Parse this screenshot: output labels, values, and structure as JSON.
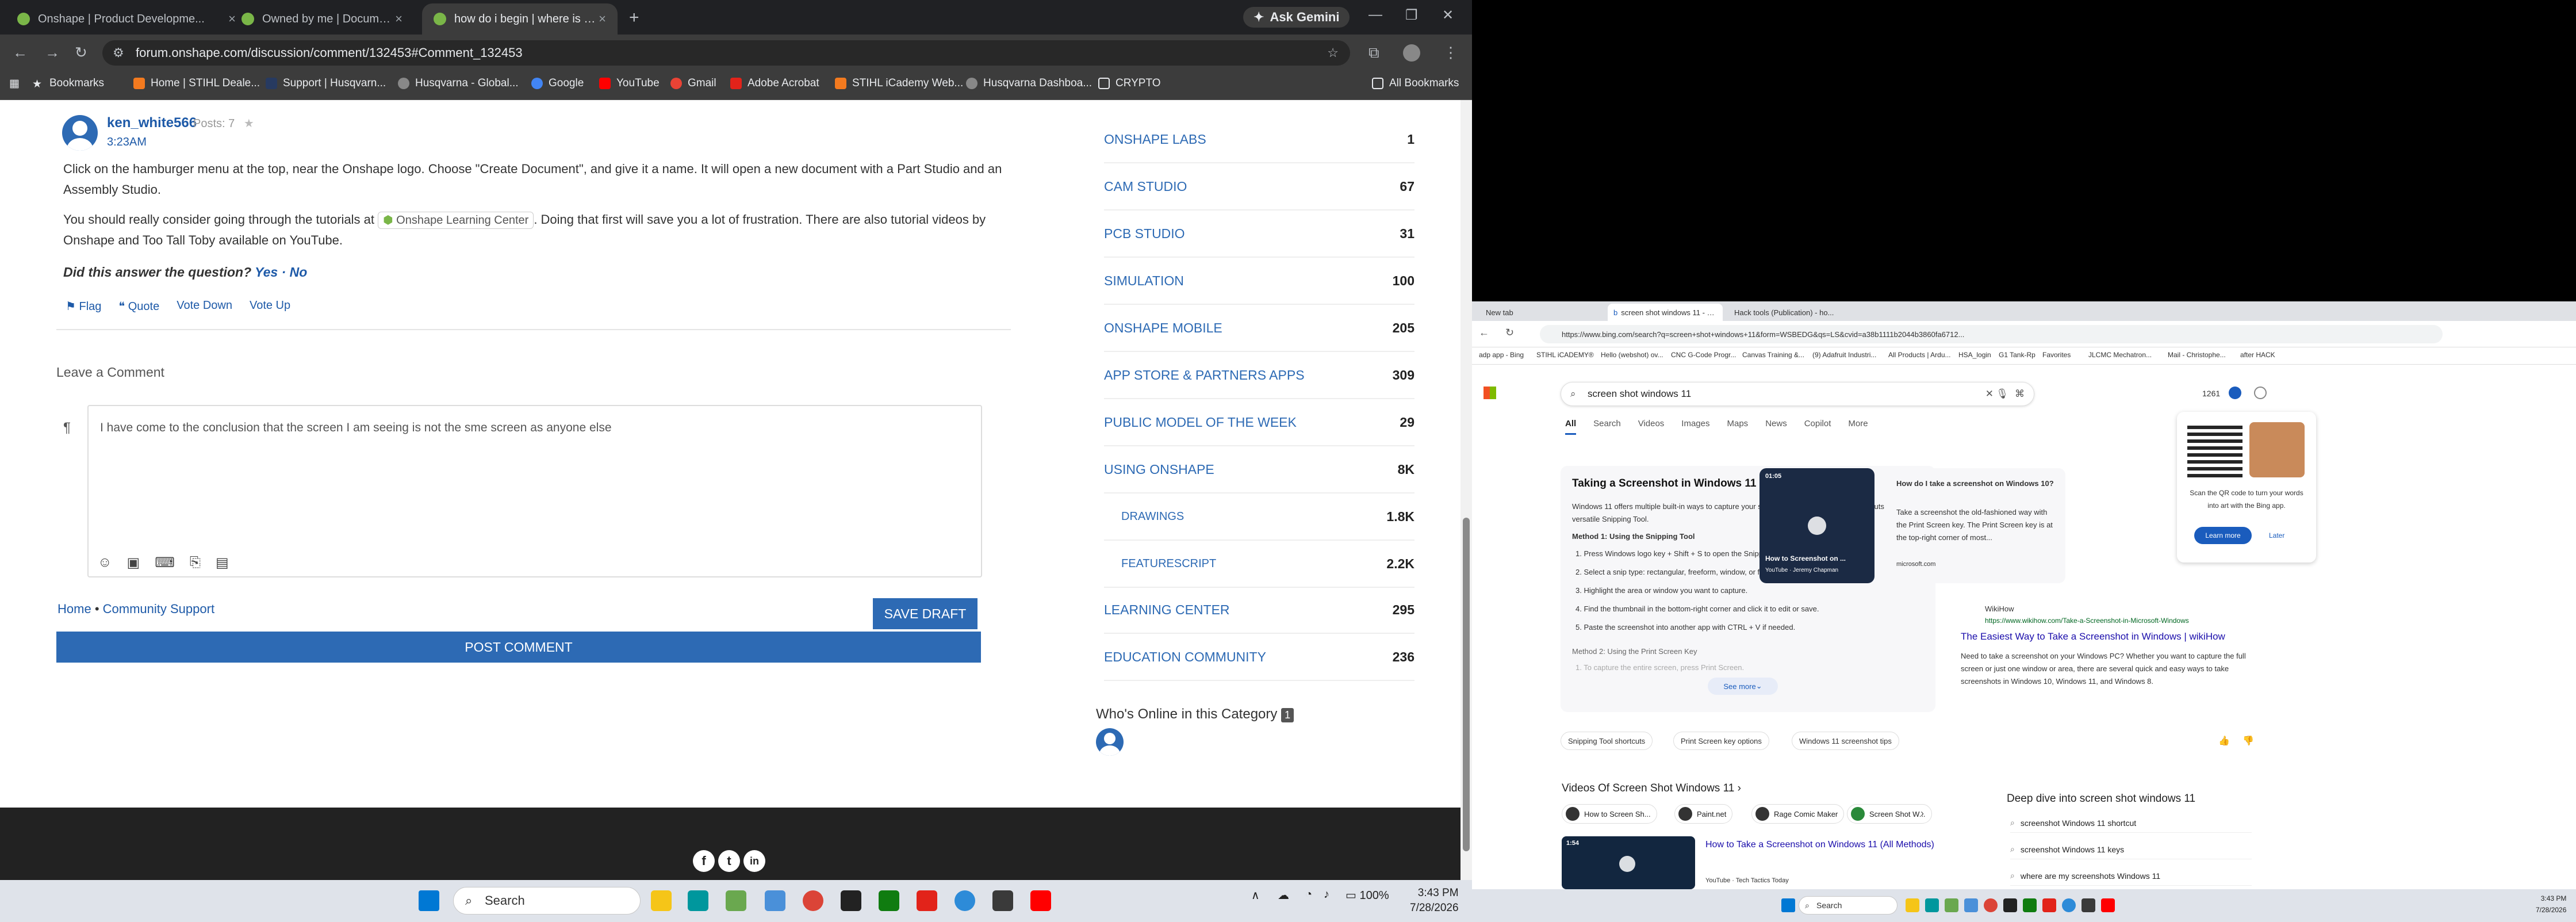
{
  "left_browser": {
    "tabs": [
      {
        "label": "Onshape | Product Developme..."
      },
      {
        "label": "Owned by me | Documents"
      },
      {
        "label": "how do i begin | where is the C..."
      }
    ],
    "ask_gemini": "Ask Gemini",
    "url": "forum.onshape.com/discussion/comment/132453#Comment_132453",
    "bookmarks": [
      "Bookmarks",
      "Home | STIHL Deale...",
      "Support | Husqvarn...",
      "Husqvarna - Global...",
      "Google",
      "YouTube",
      "Gmail",
      "Adobe Acrobat",
      "STIHL iCademy Web...",
      "Husqvarna Dashboa...",
      "CRYPTO"
    ],
    "all_bookmarks": "All Bookmarks"
  },
  "post": {
    "username": "ken_white566",
    "posts": "Posts: 7",
    "star": "★",
    "time": "3:23AM",
    "p1": "Click on the hamburger menu at the top, near the Onshape logo. Choose \"Create Document\", and give it a name. It will open a new document with a Part Studio and an Assembly Studio.",
    "p2_a": "You should really consider going through the tutorials at",
    "p2_link": "Onshape Learning Center",
    "p2_b": ". Doing that first will save you a lot of frustration. There are also tutorial videos by Onshape and Too Tall Toby available on YouTube.",
    "question": "Did this answer the question?",
    "yes": "Yes",
    "dot": "·",
    "no": "No",
    "actions": [
      "Flag",
      "Quote",
      "Vote Down",
      "Vote Up"
    ]
  },
  "comment": {
    "heading": "Leave a Comment",
    "pilcrow": "¶",
    "text": "I have come to the conclusion that the screen I am seeing is not the sme screen as anyone else",
    "breadcrumb_home": "Home",
    "breadcrumb_sep": "•",
    "breadcrumb_support": "Community Support",
    "save_draft": "SAVE DRAFT",
    "post_comment": "POST COMMENT"
  },
  "categories": [
    {
      "name": "ONSHAPE LABS",
      "count": "1"
    },
    {
      "name": "CAM STUDIO",
      "count": "67"
    },
    {
      "name": "PCB STUDIO",
      "count": "31"
    },
    {
      "name": "SIMULATION",
      "count": "100"
    },
    {
      "name": "ONSHAPE MOBILE",
      "count": "205"
    },
    {
      "name": "APP STORE & PARTNERS APPS",
      "count": "309"
    },
    {
      "name": "PUBLIC MODEL OF THE WEEK",
      "count": "29"
    },
    {
      "name": "USING ONSHAPE",
      "count": "8K"
    },
    {
      "name": "DRAWINGS",
      "count": "1.8K"
    },
    {
      "name": "FEATURESCRIPT",
      "count": "2.2K"
    },
    {
      "name": "LEARNING CENTER",
      "count": "295"
    },
    {
      "name": "EDUCATION COMMUNITY",
      "count": "236"
    }
  ],
  "who_online": "Who's Online in this Category",
  "who_online_count": "1",
  "footer_social": [
    "f",
    "t",
    "in"
  ],
  "taskbar": {
    "search": "Search",
    "time": "3:43 PM",
    "date": "7/28/2026",
    "battery": "100%"
  },
  "right_browser": {
    "tabs": [
      {
        "label": "New tab"
      },
      {
        "label": "screen shot windows 11 - Search"
      },
      {
        "label": "Hack tools (Publication) - ho..."
      }
    ],
    "url": "https://www.bing.com/search?q=screen+shot+windows+11&form=WSBEDG&qs=LS&cvid=a38b1111b2044b3860fa6712...",
    "bookmarks": [
      "adp app - Bing",
      "STIHL iCADEMY®",
      "Hello (webshot) ov...",
      "CNC G-Code Progr...",
      "Canvas Training &...",
      "(9) Adafruit Industri...",
      "All Products | Ardu...",
      "HSA_login",
      "G1 Tank-Rp",
      "Favorites",
      "JLCMC Mechatron...",
      "Mail - Christophe...",
      "after HACK"
    ],
    "search_query": "screen shot windows 11",
    "rewards": "1261",
    "nav": [
      "All",
      "Search",
      "Videos",
      "Images",
      "Maps",
      "News",
      "Copilot",
      "More"
    ],
    "answer_title": "Taking a Screenshot in Windows 11",
    "answer_intro": "Windows 11 offers multiple built-in ways to capture your screen, from quick keyboard shortcuts to the versatile Snipping Tool.",
    "method1": "Method 1: Using the Snipping Tool",
    "steps": [
      "Press Windows logo key + Shift + S to open the Snipping Tool.",
      "Select a snip type: rectangular, freeform, window, or full-screen.",
      "Highlight the area or window you want to capture.",
      "Find the thumbnail in the bottom-right corner and click it to edit or save.",
      "Paste the screenshot into another app with CTRL + V if needed."
    ],
    "method2": "Method 2: Using the Print Screen Key",
    "method2_step": "1. To capture the entire screen, press Print Screen.",
    "see_more": "See more",
    "video_duration": "01:05",
    "video_caption": "How to Screenshot on ...",
    "video_channel": "YouTube · Jeremy Chapman",
    "side_q": "How do I take a screenshot on Windows 10?",
    "side_a": "Take a screenshot the old-fashioned way with the Print Screen key. The Print Screen key is at the top-right corner of most...",
    "side_src": "microsoft.com",
    "wiki_src": "WikiHow",
    "wiki_url": "https://www.wikihow.com/Take-a-Screenshot-in-Microsoft-Windows",
    "wiki_title": "The Easiest Way to Take a Screenshot in Windows | wikiHow",
    "wiki_text": "Need to take a screenshot on your Windows PC? Whether you want to capture the full screen or just one window or area, there are several quick and easy ways to take screenshots in Windows 10, Windows 11, and Windows 8.",
    "pills": [
      "Snipping Tool shortcuts",
      "Print Screen key options",
      "Windows 11 screenshot tips"
    ],
    "videos_heading": "Videos Of Screen Shot Windows 11",
    "video_chips": [
      "How to Screen Sh...",
      "Paint.net",
      "Rage Comic Maker",
      "Screen Shot W..."
    ],
    "video2_title": "How to Take a Screenshot on Windows 11 (All Methods)",
    "video2_channel": "YouTube · Tech Tactics Today",
    "video2_duration": "1:54",
    "deep_dive": "Deep dive into screen shot windows 11",
    "related": [
      "screenshot Windows 11 shortcut",
      "screenshot Windows 11 keys",
      "where are my screenshots Windows 11"
    ],
    "qr_text": "Scan the QR code to turn your words into art with the Bing app.",
    "learn_more": "Learn more",
    "later": "Later",
    "rtask_search": "Search",
    "rtime": "3:43 PM",
    "rdate": "7/28/2026"
  },
  "colors": {
    "accent": "#2d6ab4",
    "bing_blue": "#1a5cbd"
  }
}
